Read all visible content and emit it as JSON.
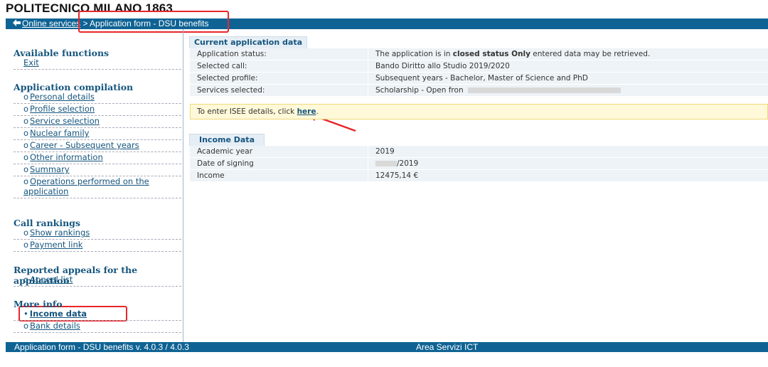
{
  "header": {
    "logo": "POLITECNICO MILANO 1863",
    "back_arrow_icon": "left-arrow-icon",
    "online_services": "Online services",
    "separator": " > ",
    "crumb_current": "Application form - DSU benefits"
  },
  "sidebar": {
    "available_functions": {
      "title": "Available functions",
      "items": [
        {
          "label": "Exit"
        }
      ]
    },
    "application_compilation": {
      "title": "Application compilation",
      "items": [
        {
          "label": "Personal details"
        },
        {
          "label": "Profile selection"
        },
        {
          "label": "Service selection"
        },
        {
          "label": "Nuclear family"
        },
        {
          "label": "Career - Subsequent years"
        },
        {
          "label": "Other information"
        },
        {
          "label": "Summary"
        },
        {
          "label": "Operations performed on the application"
        }
      ]
    },
    "call_rankings": {
      "title": "Call rankings",
      "items": [
        {
          "label": "Show rankings"
        },
        {
          "label": "Payment link"
        }
      ]
    },
    "appeals": {
      "title": "Reported appeals for the application",
      "items": [
        {
          "label": "Appeal list"
        }
      ]
    },
    "more_info": {
      "title": "More info",
      "items": [
        {
          "label": "Income data",
          "active": true
        },
        {
          "label": "Bank details"
        }
      ]
    },
    "bullet": "o",
    "active_bullet": "•"
  },
  "current_application": {
    "tab_title": "Current application data",
    "rows": [
      {
        "key": "Application status:",
        "pre": "The application is in ",
        "bold": "closed status Only",
        "post": " entered data may be retrieved."
      },
      {
        "key": "Selected call:",
        "value": "Bando Diritto allo Studio 2019/2020"
      },
      {
        "key": "Selected profile:",
        "value": "Subsequent years - Bachelor, Master of Science and PhD"
      },
      {
        "key": "Services selected:",
        "value": "Scholarship - Open fron"
      }
    ]
  },
  "notice": {
    "text": "To enter ISEE details, click ",
    "link": "here",
    "suffix": "."
  },
  "income_data": {
    "tab_title": "Income Data",
    "rows": [
      {
        "key": "Academic year",
        "value": "2019"
      },
      {
        "key": "Date of signing",
        "value": "/2019"
      },
      {
        "key": "Income",
        "value": "12475,14 €"
      }
    ]
  },
  "footer": {
    "left": "Application form - DSU benefits v. 4.0.3 / 4.0.3",
    "center": "Area Servizi ICT"
  },
  "colors": {
    "nav_blue": "#0f6394",
    "link_blue": "#15557e",
    "annotation_red": "#e8262a",
    "notice_bg": "#fff9d9"
  }
}
